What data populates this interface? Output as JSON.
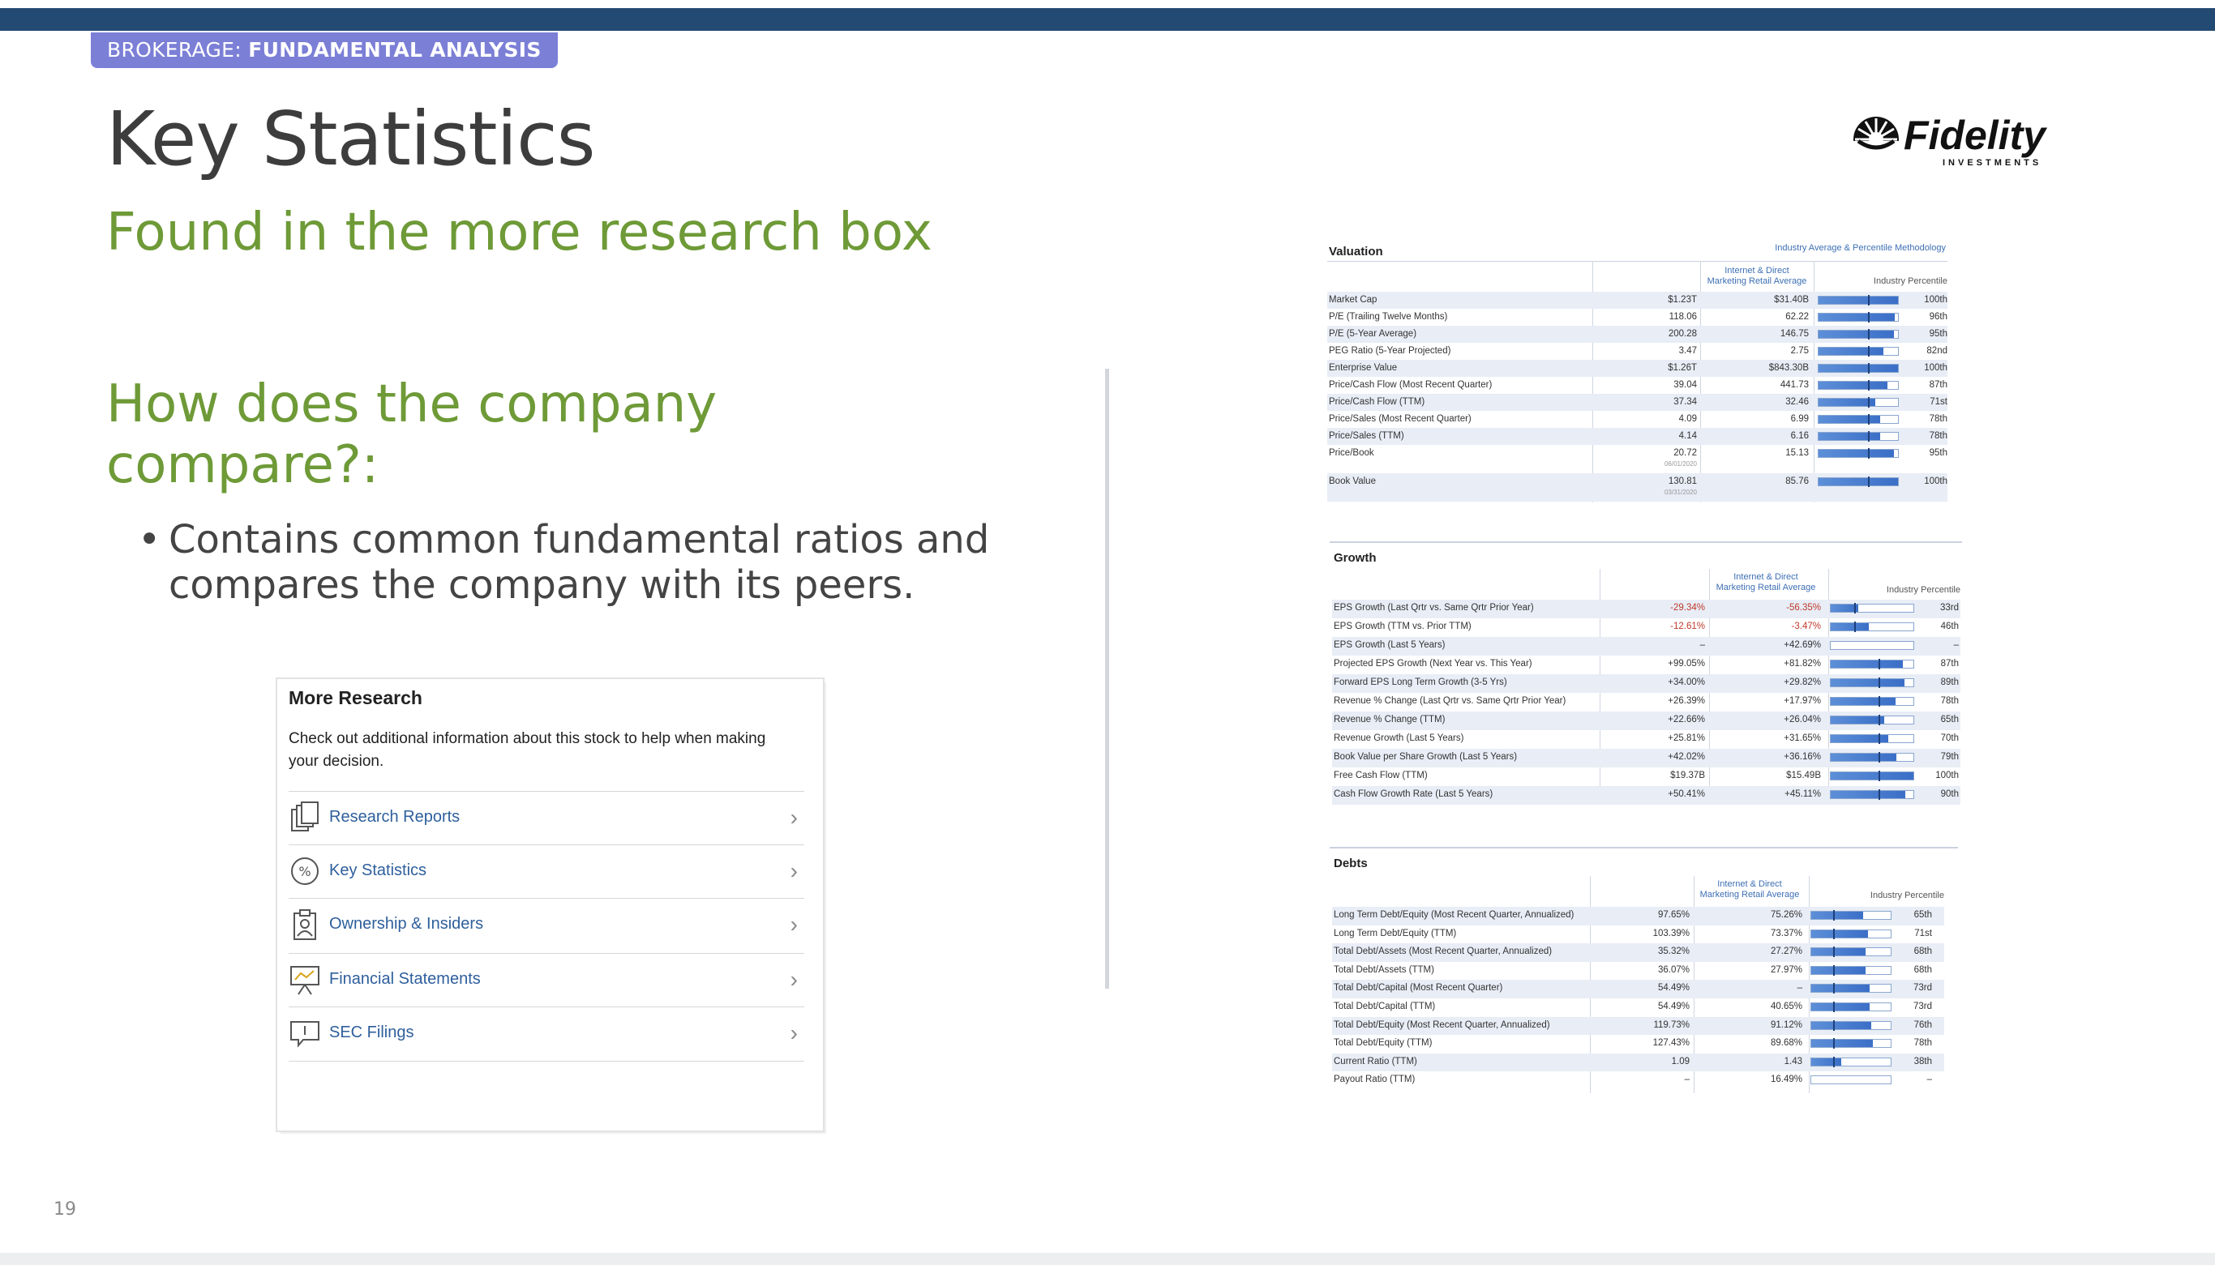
{
  "header": {
    "tag_prefix": "BROKERAGE: ",
    "tag_bold": "FUNDAMENTAL ANALYSIS",
    "title": "Key Statistics",
    "subtitle": "Found in the more research box",
    "question_line1": "How does the company",
    "question_line2": "compare?:",
    "bullet_line1": "Contains common fundamental ratios and",
    "bullet_line2": "compares the company with its peers.",
    "page_number": "19",
    "logo_text": "Fidelity",
    "logo_sub": "INVESTMENTS"
  },
  "more_research": {
    "title": "More Research",
    "description": "Check out additional information about this stock to help when making your decision.",
    "items": [
      {
        "label": "Research Reports",
        "icon": "documents-icon"
      },
      {
        "label": "Key Statistics",
        "icon": "percent-icon"
      },
      {
        "label": "Ownership & Insiders",
        "icon": "clipboard-person-icon"
      },
      {
        "label": "Financial Statements",
        "icon": "chart-easel-icon"
      },
      {
        "label": "SEC Filings",
        "icon": "speech-bubble-icon"
      }
    ]
  },
  "valuation": {
    "title": "Valuation",
    "methodology_link": "Industry Average & Percentile Methodology",
    "col2_line1": "Internet & Direct",
    "col2_line2": "Marketing Retail Average",
    "col3": "Industry Percentile",
    "rows": [
      {
        "label": "Market Cap",
        "value": "$1.23T",
        "avg": "$31.40B",
        "percentile": "100th",
        "fill": 1.0,
        "mark": 0.62
      },
      {
        "label": "P/E (Trailing Twelve Months)",
        "value": "118.06",
        "avg": "62.22",
        "percentile": "96th",
        "fill": 0.96,
        "mark": 0.62
      },
      {
        "label": "P/E (5-Year Average)",
        "value": "200.28",
        "avg": "146.75",
        "percentile": "95th",
        "fill": 0.95,
        "mark": 0.62
      },
      {
        "label": "PEG Ratio (5-Year Projected)",
        "value": "3.47",
        "avg": "2.75",
        "percentile": "82nd",
        "fill": 0.82,
        "mark": 0.62
      },
      {
        "label": "Enterprise Value",
        "value": "$1.26T",
        "avg": "$843.30B",
        "percentile": "100th",
        "fill": 1.0,
        "mark": 0.62
      },
      {
        "label": "Price/Cash Flow (Most Recent Quarter)",
        "value": "39.04",
        "avg": "441.73",
        "percentile": "87th",
        "fill": 0.87,
        "mark": 0.62
      },
      {
        "label": "Price/Cash Flow (TTM)",
        "value": "37.34",
        "avg": "32.46",
        "percentile": "71st",
        "fill": 0.71,
        "mark": 0.62
      },
      {
        "label": "Price/Sales (Most Recent Quarter)",
        "value": "4.09",
        "avg": "6.99",
        "percentile": "78th",
        "fill": 0.78,
        "mark": 0.62
      },
      {
        "label": "Price/Sales (TTM)",
        "value": "4.14",
        "avg": "6.16",
        "percentile": "78th",
        "fill": 0.78,
        "mark": 0.62
      },
      {
        "label": "Price/Book",
        "value": "20.72",
        "sub": "06/01/2020",
        "avg": "15.13",
        "percentile": "95th",
        "fill": 0.95,
        "mark": 0.62
      },
      {
        "label": "Book Value",
        "value": "130.81",
        "sub": "03/31/2020",
        "avg": "85.76",
        "percentile": "100th",
        "fill": 1.0,
        "mark": 0.62
      }
    ]
  },
  "growth": {
    "title": "Growth",
    "col2_line1": "Internet & Direct",
    "col2_line2": "Marketing Retail Average",
    "col3": "Industry Percentile",
    "rows": [
      {
        "label": "EPS Growth (Last Qrtr vs. Same Qrtr Prior Year)",
        "value": "-29.34%",
        "avg": "-56.35%",
        "percentile": "33rd",
        "fill": 0.33,
        "mark": 0.28,
        "neg": true
      },
      {
        "label": "EPS Growth (TTM vs. Prior TTM)",
        "value": "-12.61%",
        "avg": "-3.47%",
        "percentile": "46th",
        "fill": 0.46,
        "mark": 0.28,
        "neg": true
      },
      {
        "label": "EPS Growth (Last 5 Years)",
        "value": "–",
        "avg": "+42.69%",
        "percentile": "–",
        "fill": 0,
        "mark": -1
      },
      {
        "label": "Projected EPS Growth (Next Year vs. This Year)",
        "value": "+99.05%",
        "avg": "+81.82%",
        "percentile": "87th",
        "fill": 0.87,
        "mark": 0.58
      },
      {
        "label": "Forward EPS Long Term Growth (3-5 Yrs)",
        "value": "+34.00%",
        "avg": "+29.82%",
        "percentile": "89th",
        "fill": 0.89,
        "mark": 0.58
      },
      {
        "label": "Revenue % Change (Last Qrtr vs. Same Qrtr Prior Year)",
        "value": "+26.39%",
        "avg": "+17.97%",
        "percentile": "78th",
        "fill": 0.78,
        "mark": 0.58
      },
      {
        "label": "Revenue % Change (TTM)",
        "value": "+22.66%",
        "avg": "+26.04%",
        "percentile": "65th",
        "fill": 0.65,
        "mark": 0.58
      },
      {
        "label": "Revenue Growth (Last 5 Years)",
        "value": "+25.81%",
        "avg": "+31.65%",
        "percentile": "70th",
        "fill": 0.7,
        "mark": 0.58
      },
      {
        "label": "Book Value per Share Growth (Last 5 Years)",
        "value": "+42.02%",
        "avg": "+36.16%",
        "percentile": "79th",
        "fill": 0.79,
        "mark": 0.58
      },
      {
        "label": "Free Cash Flow (TTM)",
        "value": "$19.37B",
        "avg": "$15.49B",
        "percentile": "100th",
        "fill": 1.0,
        "mark": 0.58
      },
      {
        "label": "Cash Flow Growth Rate (Last 5 Years)",
        "value": "+50.41%",
        "avg": "+45.11%",
        "percentile": "90th",
        "fill": 0.9,
        "mark": 0.58
      }
    ]
  },
  "debts": {
    "title": "Debts",
    "col2_line1": "Internet & Direct",
    "col2_line2": "Marketing Retail Average",
    "col3": "Industry Percentile",
    "rows": [
      {
        "label": "Long Term Debt/Equity (Most Recent Quarter, Annualized)",
        "value": "97.65%",
        "avg": "75.26%",
        "percentile": "65th",
        "fill": 0.65,
        "mark": 0.28
      },
      {
        "label": "Long Term Debt/Equity (TTM)",
        "value": "103.39%",
        "avg": "73.37%",
        "percentile": "71st",
        "fill": 0.71,
        "mark": 0.28
      },
      {
        "label": "Total Debt/Assets (Most Recent Quarter, Annualized)",
        "value": "35.32%",
        "avg": "27.27%",
        "percentile": "68th",
        "fill": 0.68,
        "mark": 0.28
      },
      {
        "label": "Total Debt/Assets (TTM)",
        "value": "36.07%",
        "avg": "27.97%",
        "percentile": "68th",
        "fill": 0.68,
        "mark": 0.28
      },
      {
        "label": "Total Debt/Capital (Most Recent Quarter)",
        "value": "54.49%",
        "avg": "–",
        "percentile": "73rd",
        "fill": 0.73,
        "mark": 0.28
      },
      {
        "label": "Total Debt/Capital (TTM)",
        "value": "54.49%",
        "avg": "40.65%",
        "percentile": "73rd",
        "fill": 0.73,
        "mark": 0.28
      },
      {
        "label": "Total Debt/Equity (Most Recent Quarter, Annualized)",
        "value": "119.73%",
        "avg": "91.12%",
        "percentile": "76th",
        "fill": 0.76,
        "mark": 0.28
      },
      {
        "label": "Total Debt/Equity (TTM)",
        "value": "127.43%",
        "avg": "89.68%",
        "percentile": "78th",
        "fill": 0.78,
        "mark": 0.28
      },
      {
        "label": "Current Ratio (TTM)",
        "value": "1.09",
        "avg": "1.43",
        "percentile": "38th",
        "fill": 0.38,
        "mark": 0.28
      },
      {
        "label": "Payout Ratio (TTM)",
        "value": "–",
        "avg": "16.49%",
        "percentile": "–",
        "fill": 0,
        "mark": -1
      }
    ]
  }
}
